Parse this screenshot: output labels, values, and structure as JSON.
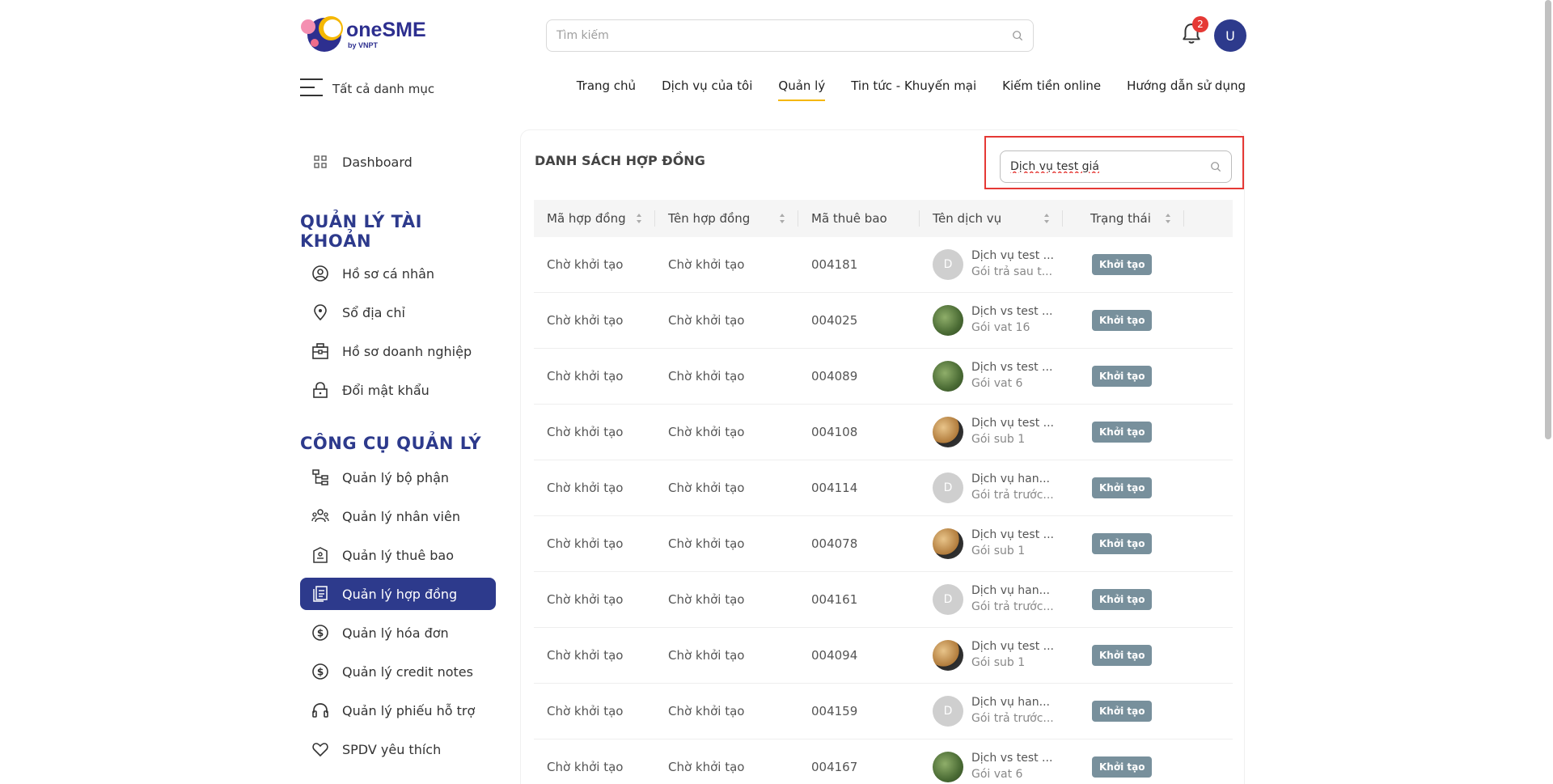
{
  "header": {
    "logo_text": "oneSME",
    "logo_sub": "by VNPT",
    "search_placeholder": "Tìm kiếm",
    "notification_count": "2",
    "user_initial": "U",
    "all_categories": "Tất cả danh mục",
    "nav": [
      {
        "label": "Trang chủ"
      },
      {
        "label": "Dịch vụ của tôi"
      },
      {
        "label": "Quản lý",
        "active": true
      },
      {
        "label": "Tin tức - Khuyến mại"
      },
      {
        "label": "Kiếm tiền online"
      },
      {
        "label": "Hướng dẫn sử dụng"
      }
    ]
  },
  "sidebar": {
    "dashboard": "Dashboard",
    "account_heading": "QUẢN LÝ TÀI KHOẢN",
    "account_items": [
      {
        "label": "Hồ sơ cá nhân",
        "icon": "user-circle-icon"
      },
      {
        "label": "Sổ địa chỉ",
        "icon": "location-pin-icon"
      },
      {
        "label": "Hồ sơ doanh nghiệp",
        "icon": "building-icon"
      },
      {
        "label": "Đổi mật khẩu",
        "icon": "lock-icon"
      }
    ],
    "tools_heading": "CÔNG CỤ QUẢN LÝ",
    "tools_items": [
      {
        "label": "Quản lý bộ phận",
        "icon": "org-chart-icon"
      },
      {
        "label": "Quản lý nhân viên",
        "icon": "users-icon"
      },
      {
        "label": "Quản lý thuê bao",
        "icon": "subscription-icon"
      },
      {
        "label": "Quản lý hợp đồng",
        "icon": "contract-icon",
        "active": true
      },
      {
        "label": "Quản lý hóa đơn",
        "icon": "dollar-circle-icon"
      },
      {
        "label": "Quản lý credit notes",
        "icon": "dollar-circle-icon"
      },
      {
        "label": "Quản lý phiếu hỗ trợ",
        "icon": "headset-icon"
      },
      {
        "label": "SPDV yêu thích",
        "icon": "heart-icon"
      }
    ]
  },
  "main": {
    "title": "DANH SÁCH HỢP ĐỒNG",
    "search_value": "Dịch vụ test giá",
    "columns": [
      "Mã hợp đồng",
      "Tên hợp đồng",
      "Mã thuê bao",
      "Tên dịch vụ",
      "Trạng thái"
    ],
    "rows": [
      {
        "code": "Chờ khởi tạo",
        "name": "Chờ khởi tạo",
        "sub": "004181",
        "svc": "Dịch vụ test ...",
        "pkg": "Gói trả sau t...",
        "avatar": "D",
        "avatar_style": "d",
        "status": "Khởi tạo"
      },
      {
        "code": "Chờ khởi tạo",
        "name": "Chờ khởi tạo",
        "sub": "004025",
        "svc": "Dịch vs test ...",
        "pkg": "Gói vat 16",
        "avatar": "",
        "avatar_style": "green",
        "status": "Khởi tạo"
      },
      {
        "code": "Chờ khởi tạo",
        "name": "Chờ khởi tạo",
        "sub": "004089",
        "svc": "Dịch vs test ...",
        "pkg": "Gói vat 6",
        "avatar": "",
        "avatar_style": "green",
        "status": "Khởi tạo"
      },
      {
        "code": "Chờ khởi tạo",
        "name": "Chờ khởi tạo",
        "sub": "004108",
        "svc": "Dịch vụ test ...",
        "pkg": "Gói sub 1",
        "avatar": "",
        "avatar_style": "brown",
        "status": "Khởi tạo"
      },
      {
        "code": "Chờ khởi tạo",
        "name": "Chờ khởi tạo",
        "sub": "004114",
        "svc": "Dịch vụ han...",
        "pkg": "Gói trả trước...",
        "avatar": "D",
        "avatar_style": "d",
        "status": "Khởi tạo"
      },
      {
        "code": "Chờ khởi tạo",
        "name": "Chờ khởi tạo",
        "sub": "004078",
        "svc": "Dịch vụ test ...",
        "pkg": "Gói sub 1",
        "avatar": "",
        "avatar_style": "brown",
        "status": "Khởi tạo"
      },
      {
        "code": "Chờ khởi tạo",
        "name": "Chờ khởi tạo",
        "sub": "004161",
        "svc": "Dịch vụ han...",
        "pkg": "Gói trả trước...",
        "avatar": "D",
        "avatar_style": "d",
        "status": "Khởi tạo"
      },
      {
        "code": "Chờ khởi tạo",
        "name": "Chờ khởi tạo",
        "sub": "004094",
        "svc": "Dịch vụ test ...",
        "pkg": "Gói sub 1",
        "avatar": "",
        "avatar_style": "brown",
        "status": "Khởi tạo"
      },
      {
        "code": "Chờ khởi tạo",
        "name": "Chờ khởi tạo",
        "sub": "004159",
        "svc": "Dịch vụ han...",
        "pkg": "Gói trả trước...",
        "avatar": "D",
        "avatar_style": "d",
        "status": "Khởi tạo"
      },
      {
        "code": "Chờ khởi tạo",
        "name": "Chờ khởi tạo",
        "sub": "004167",
        "svc": "Dịch vs test ...",
        "pkg": "Gói vat 6",
        "avatar": "",
        "avatar_style": "green",
        "status": "Khởi tạo"
      }
    ]
  },
  "colors": {
    "primary": "#2d3a8c",
    "accent": "#f5b700",
    "badge": "#78909c",
    "highlight": "#e53935"
  }
}
